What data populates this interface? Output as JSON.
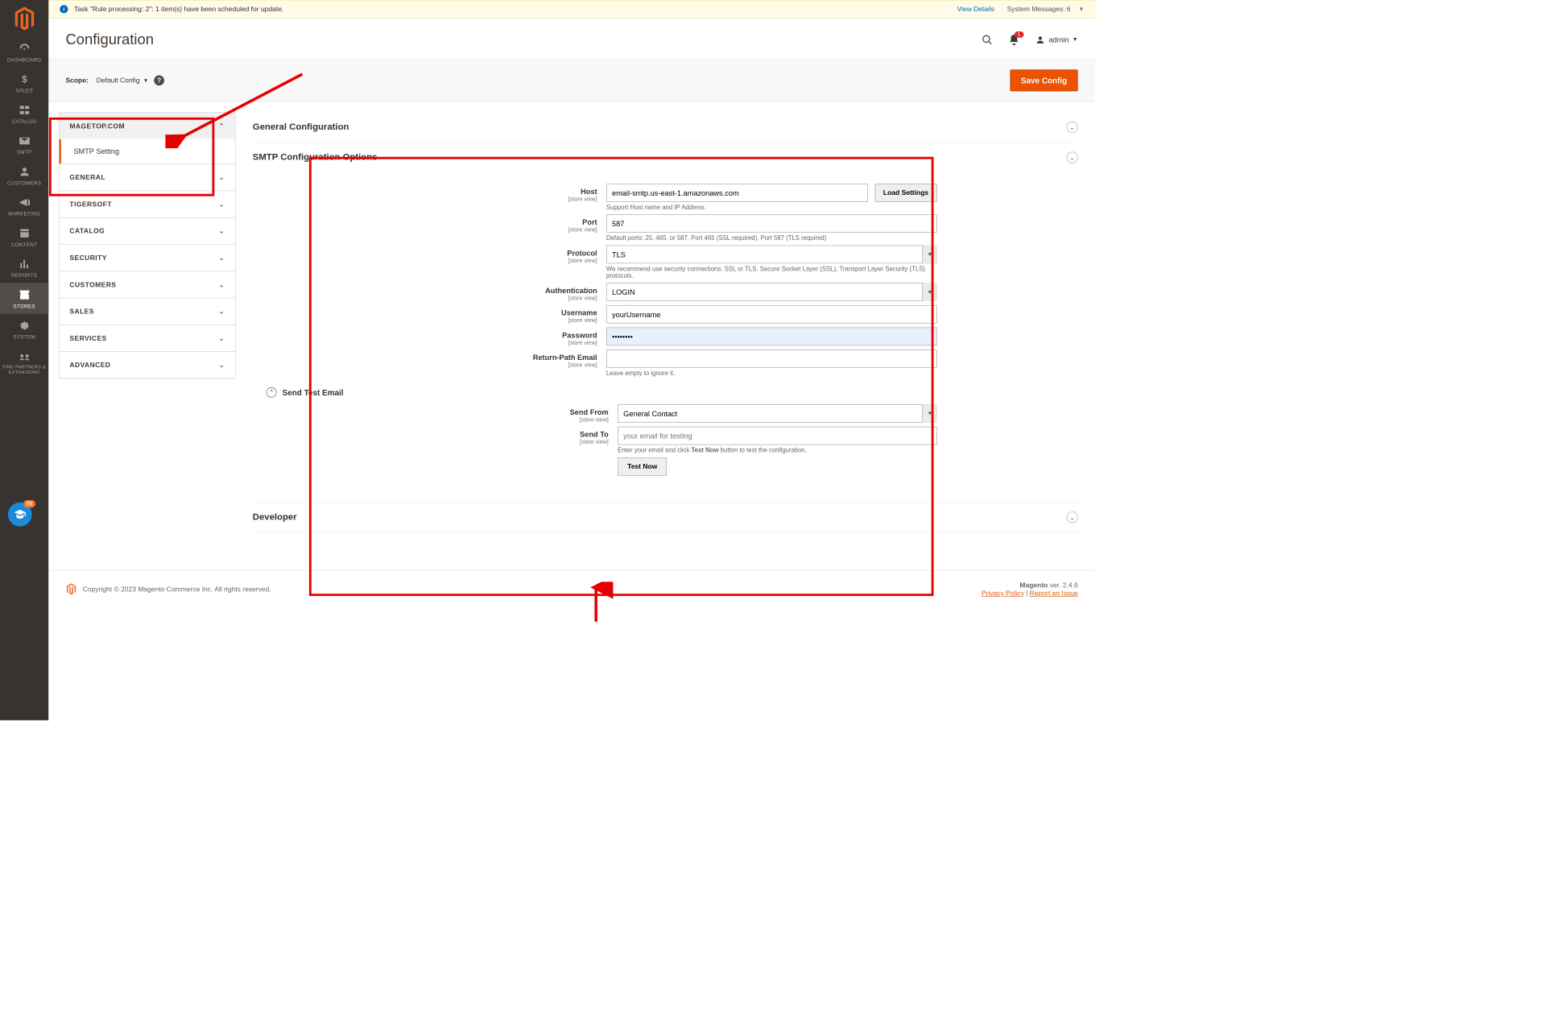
{
  "sidebar": {
    "items": [
      {
        "label": "DASHBOARD",
        "icon": "dashboard-icon"
      },
      {
        "label": "SALES",
        "icon": "dollar-icon"
      },
      {
        "label": "CATALOG",
        "icon": "catalog-icon"
      },
      {
        "label": "SMTP",
        "icon": "smtp-icon"
      },
      {
        "label": "CUSTOMERS",
        "icon": "customers-icon"
      },
      {
        "label": "MARKETING",
        "icon": "marketing-icon"
      },
      {
        "label": "CONTENT",
        "icon": "content-icon"
      },
      {
        "label": "REPORTS",
        "icon": "reports-icon"
      },
      {
        "label": "STORES",
        "icon": "stores-icon",
        "active": true
      },
      {
        "label": "SYSTEM",
        "icon": "system-icon"
      },
      {
        "label": "FIND PARTNERS & EXTENSIONS",
        "icon": "partners-icon"
      }
    ],
    "float_badge": "66"
  },
  "msgbar": {
    "text": "Task \"Rule processing: 2\": 1 item(s) have been scheduled for update.",
    "view": "View Details",
    "system": "System Messages:",
    "count": "6"
  },
  "page": {
    "title": "Configuration"
  },
  "header": {
    "admin": "admin",
    "bell_count": "1"
  },
  "scope": {
    "label": "Scope:",
    "value": "Default Config"
  },
  "save_btn": "Save Config",
  "config_nav": {
    "sections": [
      {
        "label": "MAGETOP.COM",
        "expanded": true,
        "sub": "SMTP Setting"
      },
      {
        "label": "GENERAL"
      },
      {
        "label": "TIGERSOFT"
      },
      {
        "label": "CATALOG"
      },
      {
        "label": "SECURITY"
      },
      {
        "label": "CUSTOMERS"
      },
      {
        "label": "SALES"
      },
      {
        "label": "SERVICES"
      },
      {
        "label": "ADVANCED"
      }
    ]
  },
  "sections": {
    "general": "General Configuration",
    "smtp": "SMTP Configuration Options",
    "developer": "Developer"
  },
  "scope_hint": "[store view]",
  "smtp": {
    "host": {
      "label": "Host",
      "value": "email-smtp.us-east-1.amazonaws.com",
      "hint": "Support Host name and IP Address",
      "load": "Load Settings"
    },
    "port": {
      "label": "Port",
      "value": "587",
      "hint": "Default ports: 25, 465, or 587. Port 465 (SSL required), Port 587 (TLS required)"
    },
    "protocol": {
      "label": "Protocol",
      "value": "TLS",
      "hint": "We recommend use security connections: SSL or TLS. Secure Socket Layer (SSL), Transport Layer Security (TLS) protocols."
    },
    "auth": {
      "label": "Authentication",
      "value": "LOGIN"
    },
    "user": {
      "label": "Username",
      "value": "yourUsername"
    },
    "pass": {
      "label": "Password",
      "value": "••••••••"
    },
    "return": {
      "label": "Return-Path Email",
      "value": "",
      "hint": "Leave empty to ignore it."
    }
  },
  "test": {
    "heading": "Send Test Email",
    "from": {
      "label": "Send From",
      "value": "General Contact"
    },
    "to": {
      "label": "Send To",
      "placeholder": "your email for testing",
      "hint_pre": "Enter your email and click ",
      "hint_bold": "Test Now",
      "hint_post": " button to test the configuration."
    },
    "btn": "Test Now"
  },
  "footer": {
    "copyright": "Copyright © 2023 Magento Commerce Inc. All rights reserved.",
    "product": "Magento",
    "ver": " ver. 2.4.6",
    "privacy": "Privacy Policy",
    "report": "Report an Issue"
  }
}
